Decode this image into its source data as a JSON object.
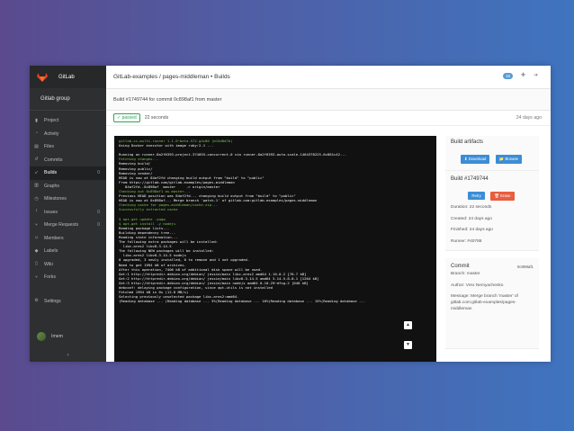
{
  "app": {
    "name": "GitLab",
    "group": "Gitlab group"
  },
  "sidebar": {
    "items": [
      {
        "label": "Project",
        "icon": "bookmark-icon",
        "count": ""
      },
      {
        "label": "Activity",
        "icon": "dashboard-icon",
        "count": ""
      },
      {
        "label": "Files",
        "icon": "files-icon",
        "count": ""
      },
      {
        "label": "Commits",
        "icon": "history-icon",
        "count": ""
      },
      {
        "label": "Builds",
        "icon": "rocket-icon",
        "count": "0"
      },
      {
        "label": "Graphs",
        "icon": "chart-icon",
        "count": ""
      },
      {
        "label": "Milestones",
        "icon": "clock-icon",
        "count": ""
      },
      {
        "label": "Issues",
        "icon": "exclamation-icon",
        "count": "0"
      },
      {
        "label": "Merge Requests",
        "icon": "merge-icon",
        "count": "0"
      },
      {
        "label": "Members",
        "icon": "users-icon",
        "count": ""
      },
      {
        "label": "Labels",
        "icon": "tags-icon",
        "count": ""
      },
      {
        "label": "Wiki",
        "icon": "book-icon",
        "count": ""
      },
      {
        "label": "Forks",
        "icon": "fork-icon",
        "count": ""
      },
      {
        "label": "Settings",
        "icon": "gear-icon",
        "count": ""
      }
    ],
    "active_index": 4,
    "user": "Imem",
    "collapse": "‹"
  },
  "topbar": {
    "breadcrumb": "GitLab-examples / pages-middleman • Builds",
    "badge": "15"
  },
  "build": {
    "header": "Build #1749744 for commit 0c898af1 from master",
    "status": "passed",
    "duration": "22 seconds",
    "ago": "24 days ago"
  },
  "log_lines": [
    {
      "t": "gitlab-ci-multi-runner 1.1.0~beta.572.g4c80 (b15d8d7b)",
      "c": "g"
    },
    {
      "t": "Using Docker executor with image ruby:2.1 ...",
      "c": "w"
    },
    {
      "t": "",
      "c": "w"
    },
    {
      "t": "Running on runner-8a2f6393-project-374055-concurrent-0 via runner-8a2f6393-auto-scale-1464378225-6c881c42...",
      "c": "w"
    },
    {
      "t": "Fetching changes...",
      "c": "g"
    },
    {
      "t": "Removing build/",
      "c": "w"
    },
    {
      "t": "Removing public/",
      "c": "w"
    },
    {
      "t": "Removing vendor/",
      "c": "w"
    },
    {
      "t": "HEAD is now at 84af2fd changing build output from \"build\" to \"public\"",
      "c": "w"
    },
    {
      "t": "From https://gitlab.com/gitlab-examples/pages-middleman",
      "c": "w"
    },
    {
      "t": "   84af2fd..0c898af  master     -> origin/master",
      "c": "w"
    },
    {
      "t": "Checking out 0c898af1 as master...",
      "c": "g"
    },
    {
      "t": "Previous HEAD position was 84af2fd... changing build output from \"build\" to \"public\"",
      "c": "w"
    },
    {
      "t": "HEAD is now at 0c898af... Merge branch 'patch-1' of gitlab.com:gitlab-examples/pages-middleman",
      "c": "w"
    },
    {
      "t": "Checking cache for pages-middleman/cache.zip...",
      "c": "g"
    },
    {
      "t": "Successfully extracted cache",
      "c": "g"
    },
    {
      "t": "",
      "c": "w"
    },
    {
      "t": "$ apt-get update -yqqq",
      "c": "g"
    },
    {
      "t": "$ apt-get install -y nodejs",
      "c": "g"
    },
    {
      "t": "Reading package lists...",
      "c": "w"
    },
    {
      "t": "Building dependency tree...",
      "c": "w"
    },
    {
      "t": "Reading state information...",
      "c": "w"
    },
    {
      "t": "The following extra packages will be installed:",
      "c": "w"
    },
    {
      "t": "  libc-ares2 libv8-3.14.5",
      "c": "w"
    },
    {
      "t": "The following NEW packages will be installed:",
      "c": "w"
    },
    {
      "t": "  libc-ares2 libv8-3.14.5 nodejs",
      "c": "w"
    },
    {
      "t": "0 upgraded, 3 newly installed, 0 to remove and 1 not upgraded.",
      "c": "w"
    },
    {
      "t": "Need to get 1994 kB of archives.",
      "c": "w"
    },
    {
      "t": "After this operation, 7406 kB of additional disk space will be used.",
      "c": "w"
    },
    {
      "t": "Get:1 http://httpredir.debian.org/debian/ jessie/main libc-ares2 amd64 1.10.0-2 [76.7 kB]",
      "c": "w"
    },
    {
      "t": "Get:2 http://httpredir.debian.org/debian/ jessie/main libv8-3.14.5 amd64 3.14.5.8-8.1 [1264 kB]",
      "c": "w"
    },
    {
      "t": "Get:3 http://httpredir.debian.org/debian/ jessie/main nodejs amd64 0.10.29~dfsg-2 [648 kB]",
      "c": "w"
    },
    {
      "t": "debconf: delaying package configuration, since apt-utils is not installed",
      "c": "w"
    },
    {
      "t": "Fetched 1994 kB in 0s (12.6 MB/s)",
      "c": "w"
    },
    {
      "t": "Selecting previously unselected package libc-ares2:amd64.",
      "c": "w"
    },
    {
      "t": "(Reading database ... (Reading database ... 5%(Reading database ... 10%(Reading database ... 15%(Reading database ...",
      "c": "w"
    }
  ],
  "artifacts": {
    "title": "Build artifacts",
    "download": "Download",
    "browse": "Browse"
  },
  "build_panel": {
    "title": "Build #1749744",
    "retry": "Retry",
    "erase": "Erase",
    "duration": "Duration: 22 seconds",
    "created": "Created: 24 days ago",
    "finished": "Finished: 24 days ago",
    "runner": "Runner: #40788"
  },
  "commit": {
    "title": "Commit",
    "sha": "0c898af1",
    "branch": "Branch: master",
    "author": "Author: Vrex Nemyachenko",
    "message": "Message: Merge branch 'master' of gitlab.com:gitlab-examples/pages-middleman"
  }
}
